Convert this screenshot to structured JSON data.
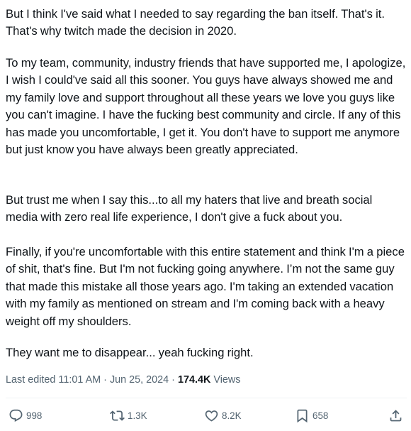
{
  "post": {
    "paragraphs": [
      "But I think I've said what I needed to say regarding the ban itself.  That's it.  That's why twitch made the decision in 2020.",
      "To my team, community, industry friends that have supported me, I apologize, I wish I could've said all this sooner.  You guys have always showed me and my family love and support throughout all these years we love you guys like you can't imagine.  I have the fucking best community and circle.  If any of this has made you uncomfortable, I get it.  You don't have to support me anymore but just know you have always been greatly appreciated.",
      "But trust me when I say this...to all my haters that live and breath social media with zero real life experience, I don't give a fuck about you.",
      "Finally, if you're uncomfortable with this entire statement and think I'm a piece of shit, that's fine. But I'm not fucking going anywhere.  I’m not the same guy that made this mistake all those years ago.  I'm taking an extended vacation with my family as mentioned on stream and I'm coming back with a heavy weight off my shoulders.",
      "They want me to disappear... yeah fucking right."
    ]
  },
  "meta": {
    "edited_label": "Last edited",
    "time": "11:01 AM",
    "separator": "·",
    "date": "Jun 25, 2024",
    "views_count": "174.4K",
    "views_label": "Views"
  },
  "actions": {
    "reply": {
      "icon": "reply-icon",
      "count": "998"
    },
    "repost": {
      "icon": "repost-icon",
      "count": "1.3K"
    },
    "like": {
      "icon": "heart-icon",
      "count": "8.2K"
    },
    "bookmark": {
      "icon": "bookmark-icon",
      "count": "658"
    },
    "share": {
      "icon": "share-icon"
    }
  },
  "colors": {
    "text": "#0f1419",
    "secondary": "#536471",
    "divider": "#eff3f4",
    "background": "#ffffff"
  }
}
